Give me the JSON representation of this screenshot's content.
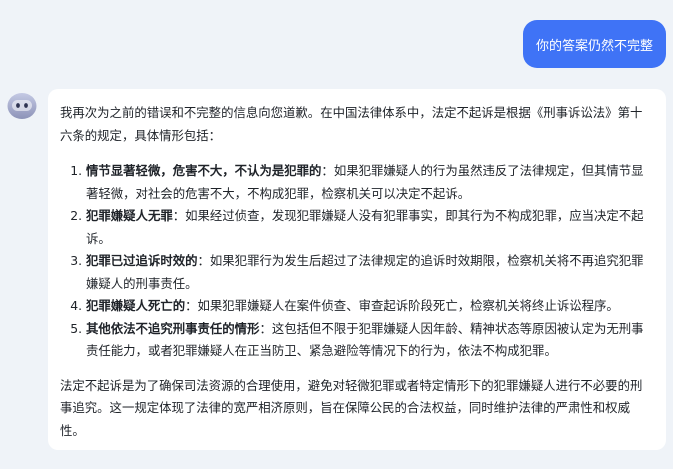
{
  "user_message": "你的答案仍然不完整",
  "assistant": {
    "intro": "我再次为之前的错误和不完整的信息向您道歉。在中国法律体系中，法定不起诉是根据《刑事诉讼法》第十六条的规定，具体情形包括：",
    "items": [
      {
        "title": "情节显著轻微，危害不大，不认为是犯罪的",
        "colon": "：",
        "text": "如果犯罪嫌疑人的行为虽然违反了法律规定，但其情节显著轻微，对社会的危害不大，不构成犯罪，检察机关可以决定不起诉。"
      },
      {
        "title": "犯罪嫌疑人无罪",
        "colon": "：",
        "text": "如果经过侦查，发现犯罪嫌疑人没有犯罪事实，即其行为不构成犯罪，应当决定不起诉。"
      },
      {
        "title": "犯罪已过追诉时效的",
        "colon": "：",
        "text": "如果犯罪行为发生后超过了法律规定的追诉时效期限，检察机关将不再追究犯罪嫌疑人的刑事责任。"
      },
      {
        "title": "犯罪嫌疑人死亡的",
        "colon": "：",
        "text": "如果犯罪嫌疑人在案件侦查、审查起诉阶段死亡，检察机关将终止诉讼程序。"
      },
      {
        "title": "其他依法不追究刑事责任的情形",
        "colon": "：",
        "text": "这包括但不限于犯罪嫌疑人因年龄、精神状态等原因被认定为无刑事责任能力，或者犯罪嫌疑人在正当防卫、紧急避险等情况下的行为，依法不构成犯罪。"
      }
    ],
    "conclusion": "法定不起诉是为了确保司法资源的合理使用，避免对轻微犯罪或者特定情形下的犯罪嫌疑人进行不必要的刑事追究。这一规定体现了法律的宽严相济原则，旨在保障公民的合法权益，同时维护法律的严肃性和权威性。"
  },
  "colors": {
    "page_background": "#eff3f8",
    "user_bubble": "#3f73f6",
    "card_background": "#ffffff",
    "text": "#1f2329"
  },
  "icons": {
    "avatar": "assistant-robot-icon"
  }
}
